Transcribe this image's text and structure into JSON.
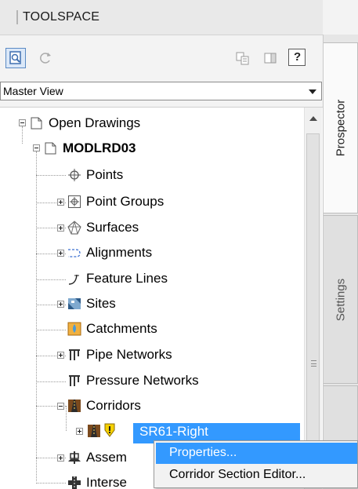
{
  "toolspace": {
    "title": "TOOLSPACE",
    "view_selector": {
      "selected": "Master View"
    },
    "toolbar": {
      "icons": [
        "item-view-icon",
        "refresh-icon",
        "copy-icon",
        "panel-icon",
        "help-icon"
      ],
      "help_label": "?"
    }
  },
  "tree": {
    "root": "Open Drawings",
    "drawing": "MODLRD03",
    "items": [
      {
        "label": "Points",
        "icon": "points-icon"
      },
      {
        "label": "Point Groups",
        "icon": "point-groups-icon"
      },
      {
        "label": "Surfaces",
        "icon": "surfaces-icon"
      },
      {
        "label": "Alignments",
        "icon": "alignments-icon"
      },
      {
        "label": "Feature Lines",
        "icon": "feature-lines-icon"
      },
      {
        "label": "Sites",
        "icon": "sites-icon"
      },
      {
        "label": "Catchments",
        "icon": "catchments-icon"
      },
      {
        "label": "Pipe Networks",
        "icon": "pipe-networks-icon"
      },
      {
        "label": "Pressure Networks",
        "icon": "pressure-networks-icon"
      },
      {
        "label": "Corridors",
        "icon": "corridors-icon"
      },
      {
        "label": "SR61-Right",
        "icon": "corridor-icon",
        "selected": true,
        "warning": true
      },
      {
        "label": "Assem",
        "icon": "assemblies-icon"
      },
      {
        "label": "Interse",
        "icon": "intersections-icon"
      }
    ]
  },
  "tabs": [
    {
      "label": "Prospector",
      "active": true
    },
    {
      "label": "Settings"
    },
    {
      "label": ""
    }
  ],
  "context_menu": {
    "items": [
      "Properties...",
      "Corridor Section Editor..."
    ],
    "highlighted": 0
  },
  "colors": {
    "selection": "#3399ff",
    "warning": "#f5d000"
  }
}
